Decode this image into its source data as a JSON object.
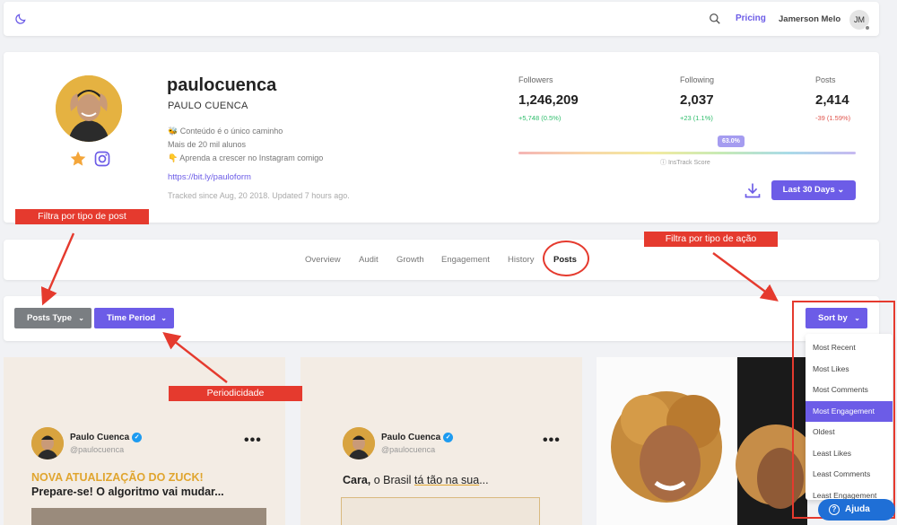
{
  "header": {
    "pricing": "Pricing",
    "user_name": "Jamerson Melo",
    "user_initials": "JM"
  },
  "profile": {
    "username": "paulocuenca",
    "full_name": "PAULO CUENCA",
    "bio": [
      "🐝 Conteúdo é o único caminho",
      "Mais de 20 mil alunos",
      "👇 Aprenda a crescer no Instagram comigo"
    ],
    "link": "https://bit.ly/pauloform",
    "tracked": "Tracked since Aug, 20 2018. Updated 7 hours ago."
  },
  "stats": {
    "followers": {
      "label": "Followers",
      "value": "1,246,209",
      "change": "+5,748 (0.5%)"
    },
    "following": {
      "label": "Following",
      "value": "2,037",
      "change": "+23 (1.1%)"
    },
    "posts": {
      "label": "Posts",
      "value": "2,414",
      "change": "-39 (1.59%)"
    }
  },
  "score": {
    "value": "63.0%",
    "label": "InsTrack Score",
    "fraction": 0.63
  },
  "period_button": "Last 30 Days",
  "tabs": [
    "Overview",
    "Audit",
    "Growth",
    "Engagement",
    "History",
    "Posts"
  ],
  "filters": {
    "posts_type": "Posts Type",
    "time_period": "Time Period",
    "sort_by": "Sort by",
    "sort_options": [
      "Most Recent",
      "Most Likes",
      "Most Comments",
      "Most Engagement",
      "Oldest",
      "Least Likes",
      "Least Comments",
      "Least Engagement"
    ]
  },
  "annotations": {
    "post_type": "Filtra por tipo de post",
    "action_type": "Filtra por tipo de ação",
    "period": "Periodicidade"
  },
  "posts": [
    {
      "name": "Paulo Cuenca",
      "handle": "@paulocuenca",
      "line1": "NOVA ATUALIZAÇÃO DO ZUCK!",
      "line2": "Prepare-se! O algoritmo vai mudar..."
    },
    {
      "name": "Paulo Cuenca",
      "handle": "@paulocuenca",
      "text_bold": "Cara,",
      "text_mid": " o Brasil ",
      "text_ul": "tá tão na sua",
      "text_end": "..."
    }
  ],
  "help": "Ajuda",
  "colors": {
    "accent": "#6c5ce7",
    "annotation": "#e53a2e",
    "positive": "#2ebd6b",
    "negative": "#e0544c"
  }
}
